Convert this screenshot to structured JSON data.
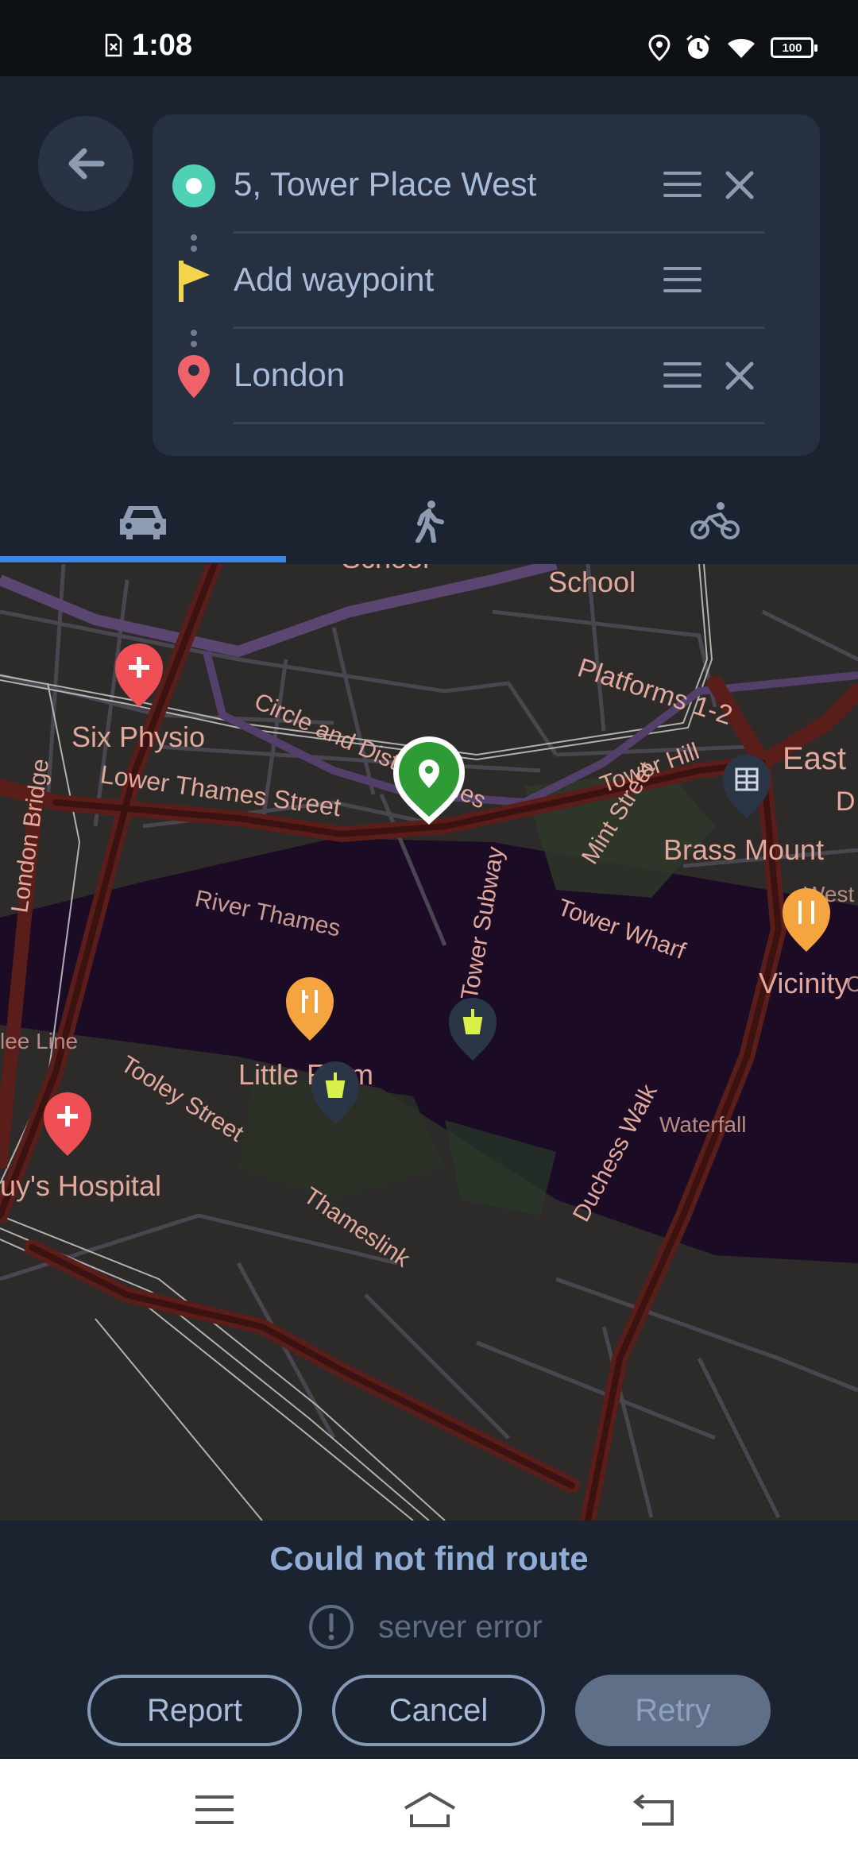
{
  "status_bar": {
    "time": "1:08",
    "battery": "100",
    "icons": [
      "sim-error-icon",
      "location-icon",
      "alarm-icon",
      "wifi-icon",
      "battery-icon"
    ]
  },
  "route": {
    "origin": "5, Tower Place West",
    "waypoint_placeholder": "Add waypoint",
    "destination": "London"
  },
  "tabs": [
    {
      "name": "car",
      "icon": "car-icon",
      "selected": true
    },
    {
      "name": "walk",
      "icon": "walk-icon",
      "selected": false
    },
    {
      "name": "bike",
      "icon": "bike-icon",
      "selected": false
    }
  ],
  "map": {
    "labels": {
      "school1": "School",
      "school2": "School",
      "platforms": "Platforms 1-2",
      "six_physio": "Six Physio",
      "circle_lines": "Circle and District Lines",
      "lower_thames": "Lower Thames Street",
      "tower_hill": "Tower Hill",
      "east": "East",
      "d_label": "D",
      "london_bridge": "London Bridge",
      "mint_street": "Mint Street",
      "brass_mount": "Brass Mount",
      "river_thames": "River Thames",
      "tower_wharf": "Tower Wharf",
      "west_label": "West",
      "c_label": "C",
      "tower_subway": "Tower Subway",
      "vicinity": "Vicinity",
      "tooley_street": "Tooley Street",
      "lee_line": "lee Line",
      "little_farm": "Little Farm",
      "waterfall": "Waterfall",
      "duchess_walk": "Duchess Walk",
      "thameslink": "Thameslink",
      "guys_hospital": "uy's Hospital"
    }
  },
  "error": {
    "title": "Could not find route",
    "message": "server error"
  },
  "buttons": {
    "report": "Report",
    "cancel": "Cancel",
    "retry": "Retry"
  },
  "colors": {
    "background": "#1b2230",
    "card": "#263040",
    "accent": "#3d86e6",
    "origin_marker": "#4fd1b5",
    "waypoint_flag": "#f3d54d",
    "destination_pin": "#f0626a",
    "map_pin": "#2e9b35"
  },
  "nav_bar": {
    "icons": [
      "menu-icon",
      "home-icon",
      "back-icon"
    ]
  }
}
